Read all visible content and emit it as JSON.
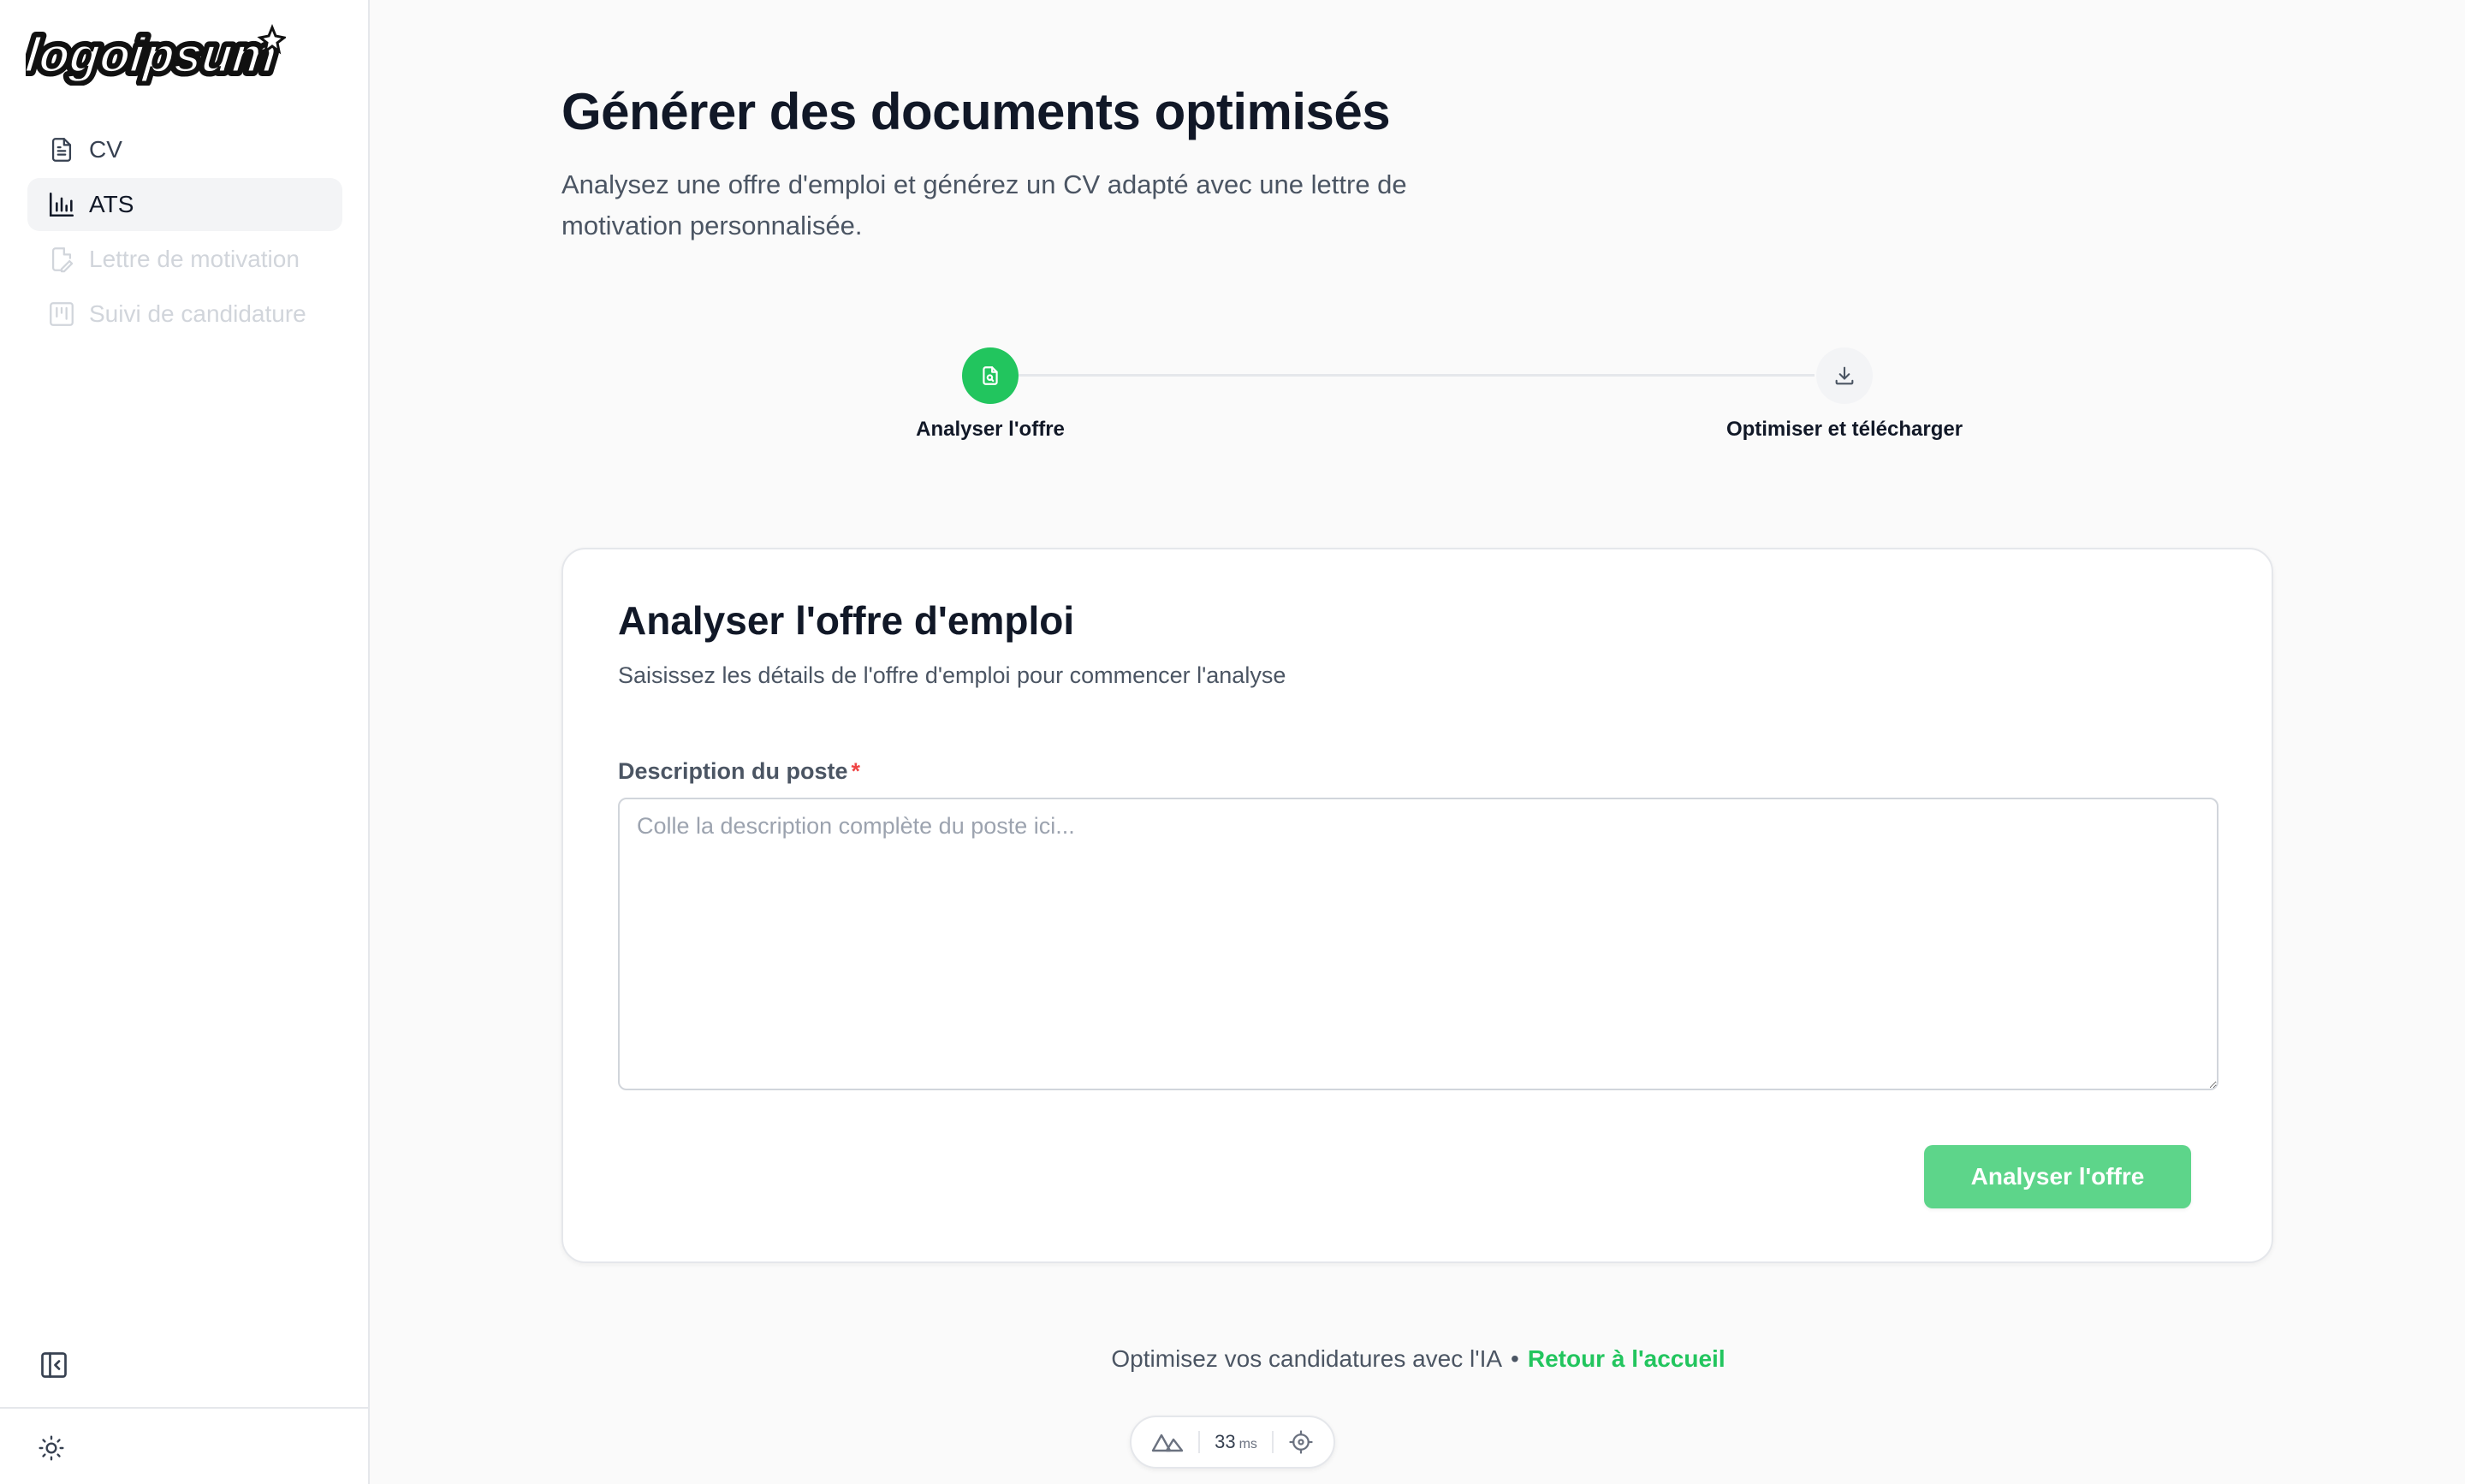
{
  "brand": {
    "logo_text": "logoipsum"
  },
  "sidebar": {
    "items": [
      {
        "label": "CV",
        "icon": "document-icon",
        "state": "normal"
      },
      {
        "label": "ATS",
        "icon": "bar-chart-icon",
        "state": "active"
      },
      {
        "label": "Lettre de motivation",
        "icon": "file-edit-icon",
        "state": "disabled"
      },
      {
        "label": "Suivi de candidature",
        "icon": "kanban-icon",
        "state": "disabled"
      }
    ],
    "collapse_icon": "sidebar-collapse-icon",
    "theme_icon": "sun-icon"
  },
  "page": {
    "title": "Générer des documents optimisés",
    "subtitle": "Analysez une offre d'emploi et générez un CV adapté avec une lettre de motivation personnalisée."
  },
  "stepper": {
    "steps": [
      {
        "label": "Analyser l'offre",
        "icon": "file-search-icon",
        "status": "current"
      },
      {
        "label": "Optimiser et télécharger",
        "icon": "download-icon",
        "status": "pending"
      }
    ]
  },
  "card": {
    "title": "Analyser l'offre d'emploi",
    "subtitle": "Saisissez les détails de l'offre d'emploi pour commencer l'analyse",
    "field_label": "Description du poste",
    "required_mark": "*",
    "textarea_value": "",
    "textarea_placeholder": "Colle la description complète du poste ici...",
    "button_label": "Analyser l'offre"
  },
  "footer": {
    "text": "Optimisez vos candidatures avec l'IA",
    "separator": "•",
    "link_label": "Retour à l'accueil"
  },
  "devtools": {
    "value": "33",
    "unit": "ms"
  },
  "colors": {
    "accent": "#22c55e",
    "button_disabled": "#5dd58a",
    "required": "#ef4444",
    "text_primary": "#111827",
    "text_secondary": "#4b5563"
  }
}
